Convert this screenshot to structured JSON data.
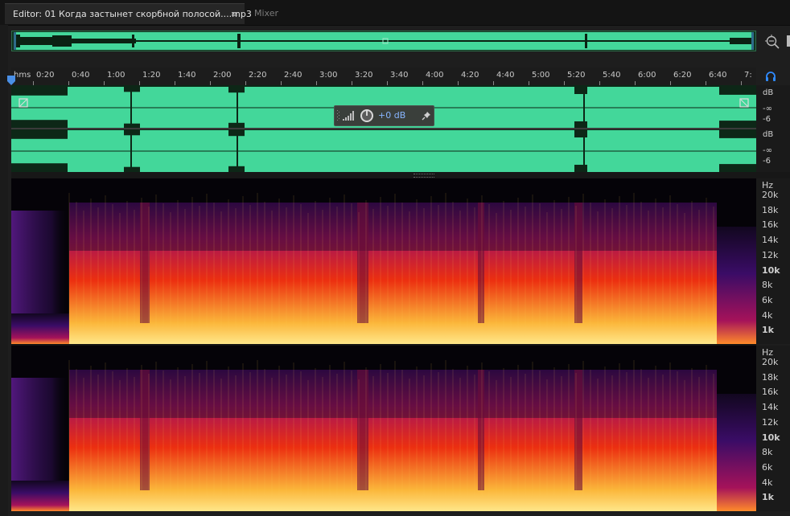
{
  "tabs": {
    "editor_label": "Editor: 01 Когда застынет скорбной полосой....mp3",
    "editor_menu": "≡",
    "mixer_label": "Mixer"
  },
  "ruler": {
    "unit": "hms",
    "ticks": [
      "0:20",
      "0:40",
      "1:00",
      "1:20",
      "1:40",
      "2:00",
      "2:20",
      "2:40",
      "3:00",
      "3:20",
      "3:40",
      "4:00",
      "4:20",
      "4:40",
      "5:00",
      "5:20",
      "5:40",
      "6:00",
      "6:20",
      "6:40",
      "7:"
    ]
  },
  "hud": {
    "volume_value": "+0 dB"
  },
  "waveform_scale": {
    "ch1": [
      "dB",
      "-∞",
      "-6"
    ],
    "ch2": [
      "dB",
      "-∞",
      "-6"
    ]
  },
  "spectral_scale": {
    "unit": "Hz",
    "ticks": [
      "20k",
      "18k",
      "16k",
      "14k",
      "12k",
      "10k",
      "8k",
      "6k",
      "4k",
      "1k"
    ],
    "bold_ticks": [
      "10k",
      "1k"
    ]
  },
  "colors": {
    "waveform": "#43d79a",
    "accent": "#2f8bff"
  },
  "icons": {
    "zoom": "zoom-selection-icon",
    "monitor": "headphones-icon",
    "volume": "volume-bars-icon",
    "pin": "pin-icon"
  }
}
